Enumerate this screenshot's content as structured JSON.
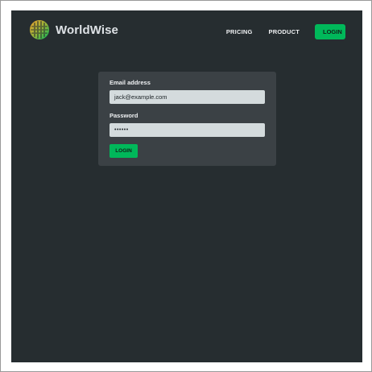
{
  "brand": {
    "name": "WorldWise",
    "icon": "worldwise-logo-icon",
    "colors": {
      "orange": "#f0832d",
      "green": "#00b85a"
    }
  },
  "nav": {
    "links": [
      "PRICING",
      "PRODUCT"
    ],
    "login_label": "LOGIN"
  },
  "form": {
    "email_label": "Email address",
    "email_value": "jack@example.com",
    "password_label": "Password",
    "password_value": "••••••",
    "submit_label": "LOGIN"
  },
  "colors": {
    "background": "#262d30",
    "card": "#3b4145",
    "input": "#d4dbdd",
    "accent": "#00b85a"
  }
}
